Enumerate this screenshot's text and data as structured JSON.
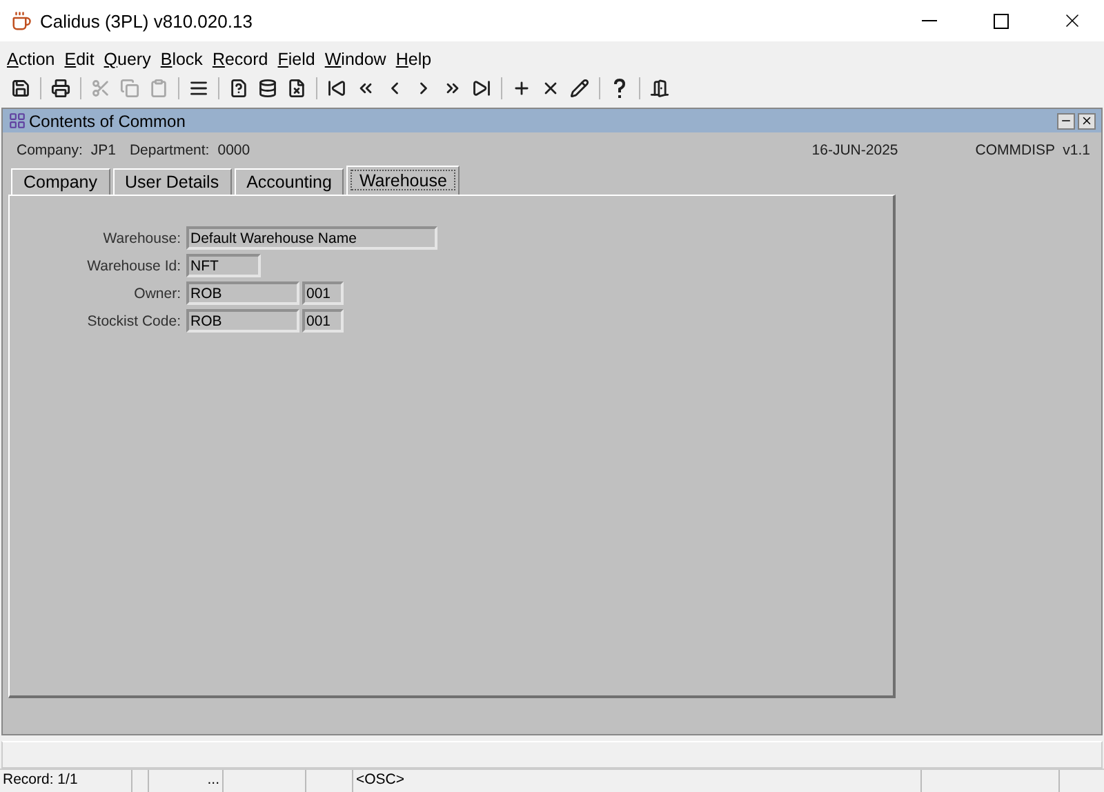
{
  "window": {
    "title": "Calidus (3PL) v810.020.13"
  },
  "menu": [
    "Action",
    "Edit",
    "Query",
    "Block",
    "Record",
    "Field",
    "Window",
    "Help"
  ],
  "toolbar": [
    {
      "kind": "save",
      "disabled": false
    },
    {
      "kind": "sep"
    },
    {
      "kind": "print",
      "disabled": false
    },
    {
      "kind": "sep"
    },
    {
      "kind": "cut",
      "disabled": true
    },
    {
      "kind": "copy",
      "disabled": true
    },
    {
      "kind": "paste",
      "disabled": true
    },
    {
      "kind": "sep"
    },
    {
      "kind": "list",
      "disabled": false
    },
    {
      "kind": "sep"
    },
    {
      "kind": "query",
      "disabled": false
    },
    {
      "kind": "execute",
      "disabled": false
    },
    {
      "kind": "cancel",
      "disabled": false
    },
    {
      "kind": "sep"
    },
    {
      "kind": "first",
      "disabled": false
    },
    {
      "kind": "prevset",
      "disabled": false
    },
    {
      "kind": "prev",
      "disabled": false
    },
    {
      "kind": "next",
      "disabled": false
    },
    {
      "kind": "nextset",
      "disabled": false
    },
    {
      "kind": "last",
      "disabled": false
    },
    {
      "kind": "sep"
    },
    {
      "kind": "insert",
      "disabled": false
    },
    {
      "kind": "delete",
      "disabled": false
    },
    {
      "kind": "edit",
      "disabled": false
    },
    {
      "kind": "sep"
    },
    {
      "kind": "help",
      "disabled": false
    },
    {
      "kind": "sep"
    },
    {
      "kind": "exit",
      "disabled": false
    }
  ],
  "form": {
    "title": "Contents of Common",
    "info": {
      "company_label": "Company:",
      "company": "JP1",
      "department_label": "Department:",
      "department": "0000",
      "date": "16-JUN-2025",
      "module": "COMMDISP  v1.1"
    },
    "tabs": [
      {
        "label": "Company",
        "selected": false
      },
      {
        "label": "User Details",
        "selected": false
      },
      {
        "label": "Accounting",
        "selected": false
      },
      {
        "label": "Warehouse",
        "selected": true
      }
    ],
    "fields": [
      {
        "label": "Warehouse:",
        "values": [
          "Default Warehouse Name"
        ]
      },
      {
        "label": "Warehouse Id:",
        "values": [
          "NFT"
        ]
      },
      {
        "label": "Owner:",
        "values": [
          "ROB",
          "001"
        ]
      },
      {
        "label": "Stockist Code:",
        "values": [
          "ROB",
          "001"
        ]
      }
    ]
  },
  "status_bar": [
    "Record: 1/1",
    "...",
    "<OSC>"
  ]
}
